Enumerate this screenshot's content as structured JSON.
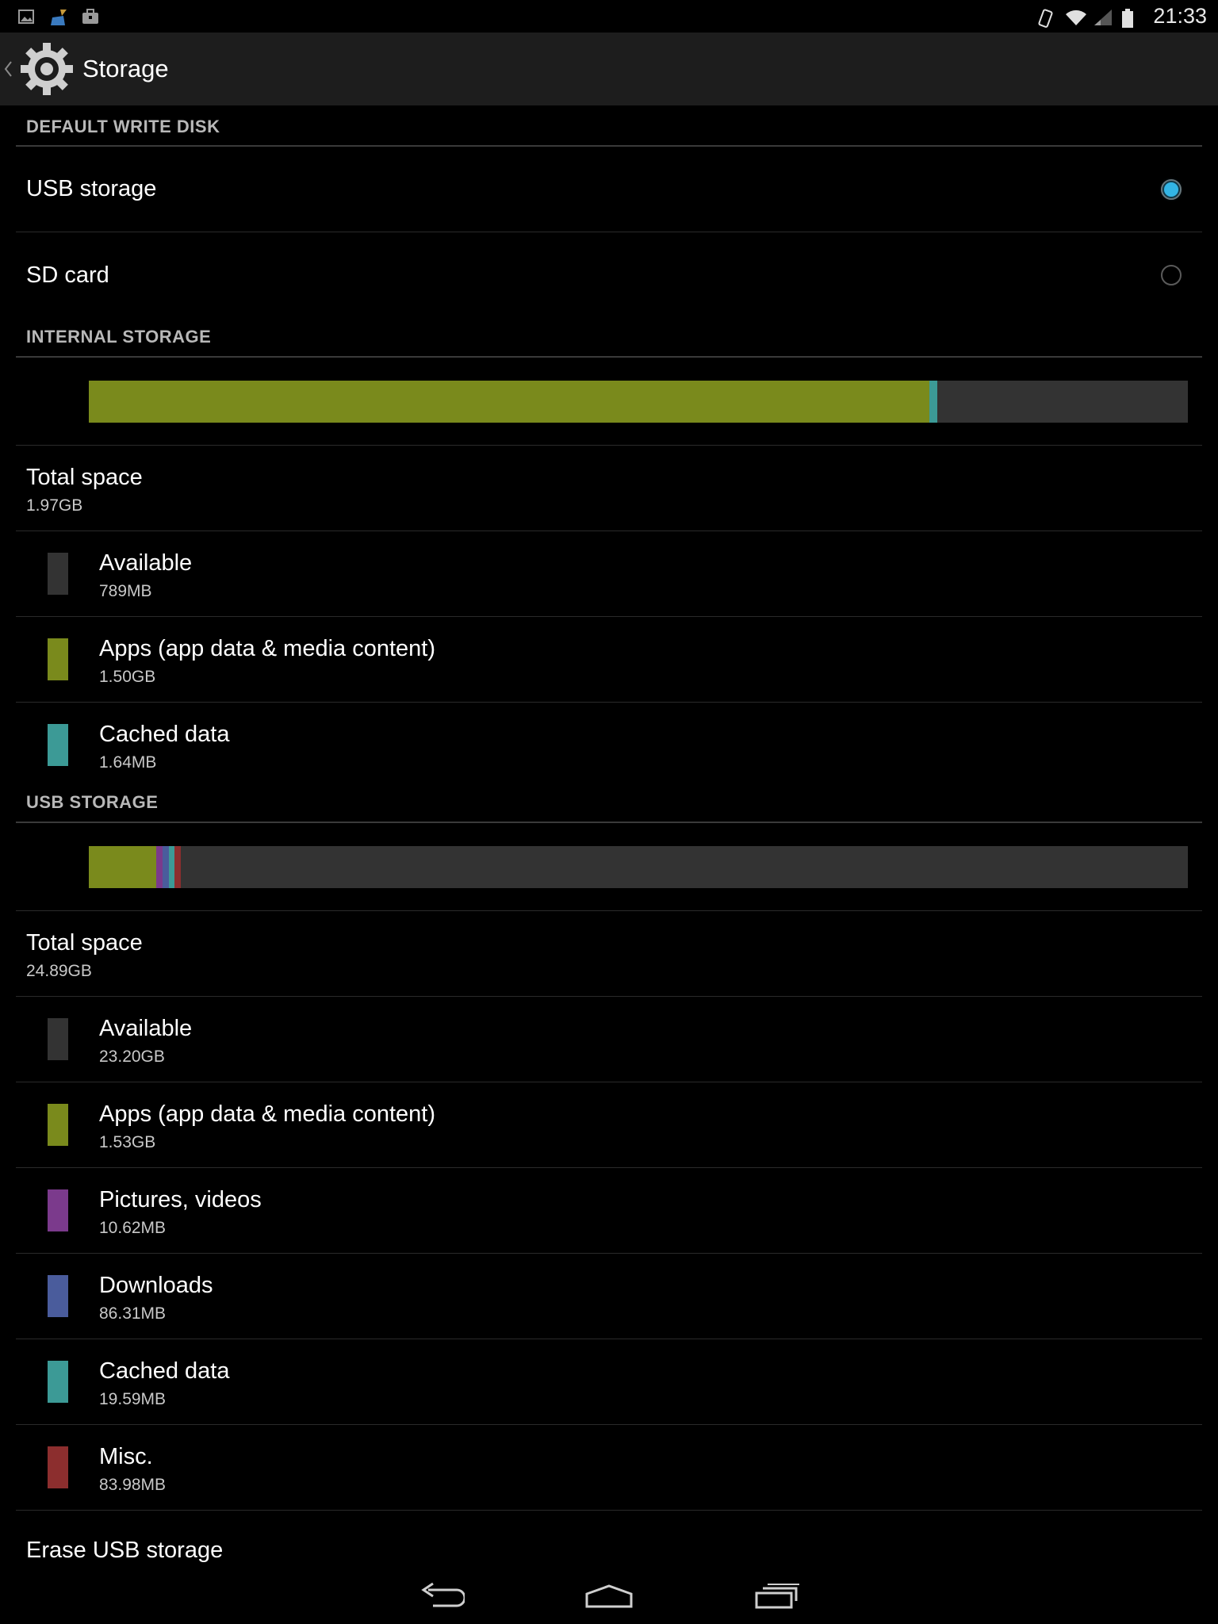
{
  "status_bar": {
    "time": "21:33",
    "left_icons": [
      "image-icon",
      "broom-icon",
      "briefcase-icon"
    ],
    "right_icons": [
      "screen-rotation-icon",
      "wifi-icon",
      "cell-signal-icon",
      "battery-icon"
    ]
  },
  "action_bar": {
    "title": "Storage",
    "icon": "settings-gear-icon"
  },
  "default_write_disk": {
    "header": "DEFAULT WRITE DISK",
    "options": [
      {
        "label": "USB storage",
        "checked": true
      },
      {
        "label": "SD card",
        "checked": false
      }
    ]
  },
  "internal_storage": {
    "header": "INTERNAL STORAGE",
    "bar_fractions": {
      "apps": 0.765,
      "cached": 0.007
    },
    "total_label": "Total space",
    "total_value": "1.97GB",
    "items": [
      {
        "label": "Available",
        "value": "789MB",
        "color": "#333333"
      },
      {
        "label": "Apps (app data & media content)",
        "value": "1.50GB",
        "color": "#7a8a1c"
      },
      {
        "label": "Cached data",
        "value": "1.64MB",
        "color": "#3c9a96"
      }
    ]
  },
  "usb_storage": {
    "header": "USB STORAGE",
    "bar_fractions": {
      "apps": 0.061,
      "pictures": 0.006,
      "downloads": 0.006,
      "cached": 0.005,
      "misc": 0.006
    },
    "total_label": "Total space",
    "total_value": "24.89GB",
    "items": [
      {
        "label": "Available",
        "value": "23.20GB",
        "color": "#333333"
      },
      {
        "label": "Apps (app data & media content)",
        "value": "1.53GB",
        "color": "#7a8a1c"
      },
      {
        "label": "Pictures, videos",
        "value": "10.62MB",
        "color": "#7b3a8c"
      },
      {
        "label": "Downloads",
        "value": "86.31MB",
        "color": "#4a5c9c"
      },
      {
        "label": "Cached data",
        "value": "19.59MB",
        "color": "#3c9a96"
      },
      {
        "label": "Misc.",
        "value": "83.98MB",
        "color": "#8c2e2e"
      }
    ],
    "erase_label": "Erase USB storage"
  },
  "nav_bar": {
    "buttons": [
      "back-icon",
      "home-icon",
      "recents-icon"
    ]
  }
}
